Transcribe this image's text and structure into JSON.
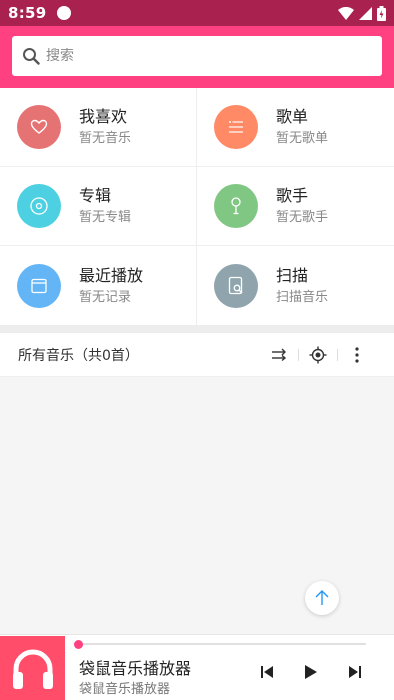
{
  "status_bar": {
    "time": "8:59"
  },
  "search": {
    "placeholder": "搜索"
  },
  "grid": {
    "items": [
      {
        "title": "我喜欢",
        "subtitle": "暂无音乐",
        "color": "#e57373",
        "icon": "heart-icon"
      },
      {
        "title": "歌单",
        "subtitle": "暂无歌单",
        "color": "#ff8a65",
        "icon": "list-icon"
      },
      {
        "title": "专辑",
        "subtitle": "暂无专辑",
        "color": "#4dd0e1",
        "icon": "disc-icon"
      },
      {
        "title": "歌手",
        "subtitle": "暂无歌手",
        "color": "#81c784",
        "icon": "microphone-icon"
      },
      {
        "title": "最近播放",
        "subtitle": "暂无记录",
        "color": "#64b5f6",
        "icon": "window-icon"
      },
      {
        "title": "扫描",
        "subtitle": "扫描音乐",
        "color": "#90a4ae",
        "icon": "scan-file-icon"
      }
    ]
  },
  "list_header": {
    "title": "所有音乐（共0首）"
  },
  "player": {
    "song_title": "袋鼠音乐播放器",
    "artist": "袋鼠音乐播放器",
    "progress": 0,
    "accent": "#ff4081",
    "album_color": "#ff4d6a"
  },
  "colors": {
    "status_bar": "#a8214f",
    "search_bar": "#ff4081",
    "fab_arrow": "#2196f3"
  }
}
